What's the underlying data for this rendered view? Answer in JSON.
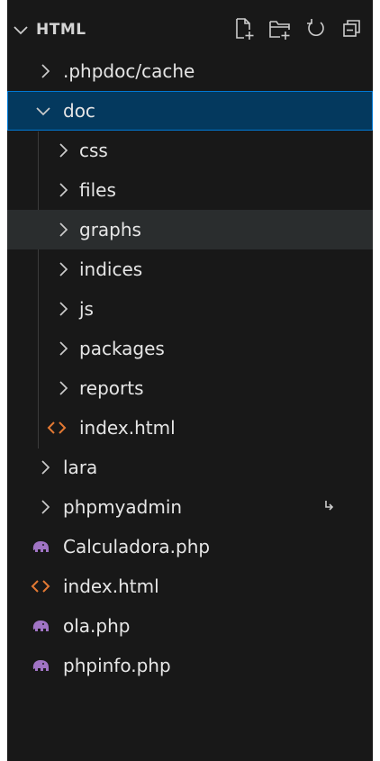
{
  "explorer": {
    "title": "HTML",
    "actions": [
      {
        "name": "new-file-icon"
      },
      {
        "name": "new-folder-icon"
      },
      {
        "name": "refresh-icon"
      },
      {
        "name": "collapse-all-icon"
      }
    ]
  },
  "tree": [
    {
      "label": ".phpdoc/cache",
      "type": "folder",
      "expanded": false,
      "depth": 0
    },
    {
      "label": "doc",
      "type": "folder",
      "expanded": true,
      "depth": 0,
      "selected": true
    },
    {
      "label": "css",
      "type": "folder",
      "expanded": false,
      "depth": 1
    },
    {
      "label": "files",
      "type": "folder",
      "expanded": false,
      "depth": 1
    },
    {
      "label": "graphs",
      "type": "folder",
      "expanded": false,
      "depth": 1,
      "hover": true
    },
    {
      "label": "indices",
      "type": "folder",
      "expanded": false,
      "depth": 1
    },
    {
      "label": "js",
      "type": "folder",
      "expanded": false,
      "depth": 1
    },
    {
      "label": "packages",
      "type": "folder",
      "expanded": false,
      "depth": 1
    },
    {
      "label": "reports",
      "type": "folder",
      "expanded": false,
      "depth": 1
    },
    {
      "label": "index.html",
      "type": "html",
      "depth": 1
    },
    {
      "label": "lara",
      "type": "folder",
      "expanded": false,
      "depth": 0
    },
    {
      "label": "phpmyadmin",
      "type": "folder",
      "expanded": false,
      "depth": 0,
      "badge": "symlink-arrow-icon"
    },
    {
      "label": "Calculadora.php",
      "type": "php",
      "depth": 0
    },
    {
      "label": "index.html",
      "type": "html",
      "depth": 0
    },
    {
      "label": "ola.php",
      "type": "php",
      "depth": 0
    },
    {
      "label": "phpinfo.php",
      "type": "php",
      "depth": 0
    }
  ],
  "colors": {
    "background": "#181818",
    "selected": "#04395e",
    "selected_border": "#0078d4",
    "hover": "#2a2d2e",
    "php_icon": "#a074c4",
    "html_icon": "#e37933",
    "text": "#e6e6e6"
  }
}
